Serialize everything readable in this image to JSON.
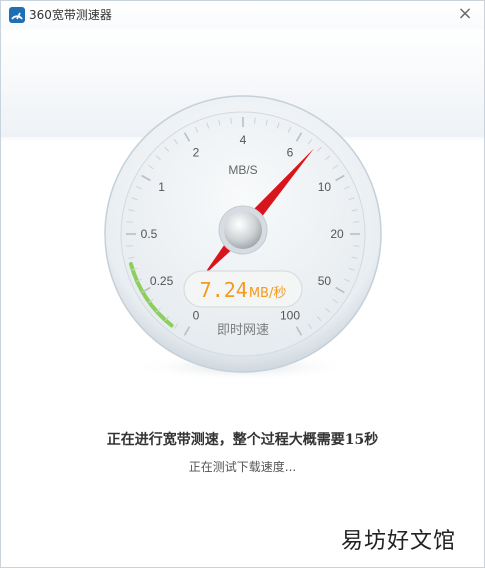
{
  "window": {
    "title": "360宽带测速器",
    "close_symbol": "×"
  },
  "icons": {
    "app": "speed-test-app-icon",
    "close": "close-icon"
  },
  "gauge": {
    "unit": "MB/S",
    "ticks": [
      "0",
      "0.25",
      "0.5",
      "1",
      "2",
      "4",
      "6",
      "10",
      "20",
      "50",
      "100"
    ],
    "needle_value": 7.24,
    "readout_value": "7.24",
    "readout_unit": "MB/秒",
    "readout_label": "即时网速",
    "colors": {
      "needle": "#d8141c",
      "readout_text": "#f29b1f",
      "progress_arc": "#8ccf5a"
    }
  },
  "status": {
    "main": "正在进行宽带测速，整个过程大概需要15秒",
    "sub": "正在测试下载速度..."
  },
  "watermark": {
    "text": "易坊好文馆"
  }
}
